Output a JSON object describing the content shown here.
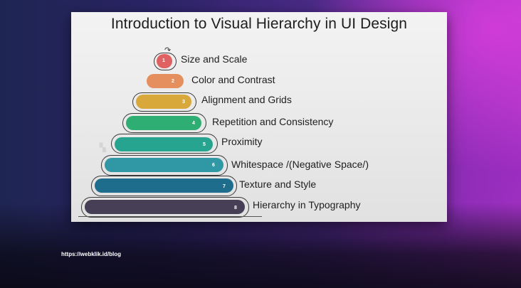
{
  "slide": {
    "title": "Introduction to Visual Hierarchy in UI Design"
  },
  "steps": [
    {
      "num": "1",
      "label": "Size and Scale",
      "color": "#e06161"
    },
    {
      "num": "2",
      "label": "Color and Contrast",
      "color": "#e58e5e"
    },
    {
      "num": "3",
      "label": "Alignment and Grids",
      "color": "#d8a83a"
    },
    {
      "num": "4",
      "label": "Repetition and Consistency",
      "color": "#2fae74"
    },
    {
      "num": "5",
      "label": "Proximity",
      "color": "#27a48f"
    },
    {
      "num": "6",
      "label": "Whitespace /(Negative Space/)",
      "color": "#2f98a4"
    },
    {
      "num": "7",
      "label": "Texture and Style",
      "color": "#1f6d8c"
    },
    {
      "num": "8",
      "label": "Hierarchy in Typography",
      "color": "#463f55"
    }
  ],
  "footer": {
    "url": "https://webklik.id/blog"
  }
}
